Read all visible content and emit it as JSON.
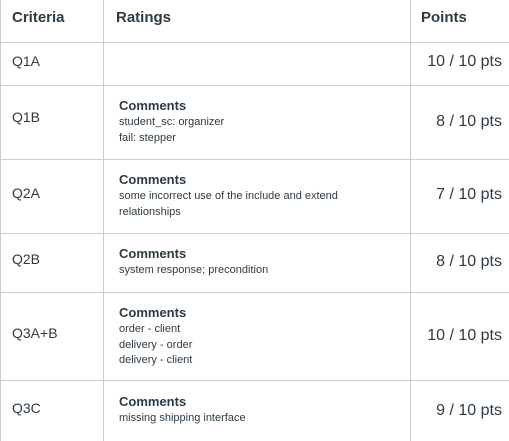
{
  "header": {
    "criteria": "Criteria",
    "ratings": "Ratings",
    "points": "Points"
  },
  "rows": [
    {
      "criterion": "Q1A",
      "comments_title": "",
      "comments": [],
      "points": "10 / 10 pts"
    },
    {
      "criterion": "Q1B",
      "comments_title": "Comments",
      "comments": [
        "student_sc: organizer",
        "fail: stepper"
      ],
      "points": "8 / 10 pts"
    },
    {
      "criterion": "Q2A",
      "comments_title": "Comments",
      "comments": [
        "some incorrect use of the include and extend",
        "relationships"
      ],
      "points": "7 / 10 pts"
    },
    {
      "criterion": "Q2B",
      "comments_title": "Comments",
      "comments": [
        "system response; precondition"
      ],
      "points": "8 / 10 pts"
    },
    {
      "criterion": "Q3A+B",
      "comments_title": "Comments",
      "comments": [
        "order - client",
        "delivery - order",
        "delivery - client"
      ],
      "points": "10 / 10 pts"
    },
    {
      "criterion": "Q3C",
      "comments_title": "Comments",
      "comments": [
        "missing shipping interface"
      ],
      "points": "9 / 10 pts"
    }
  ]
}
